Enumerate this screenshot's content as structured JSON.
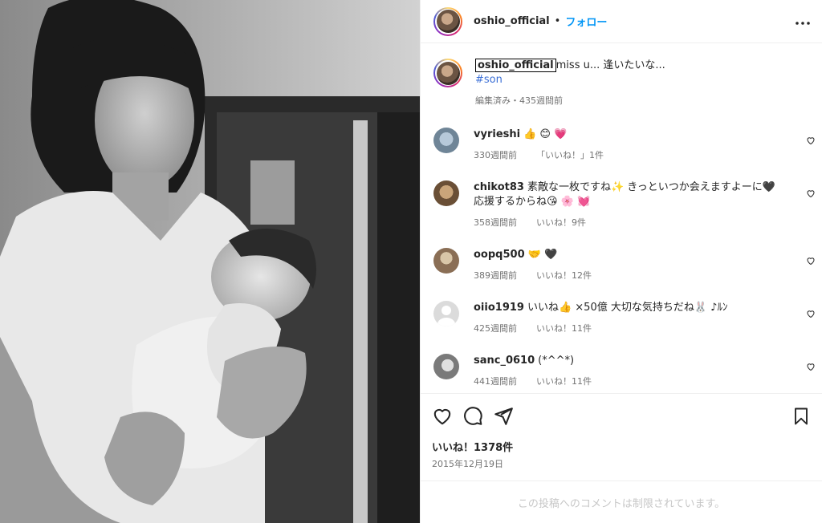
{
  "header": {
    "username": "oshio_official",
    "separator": "•",
    "follow_label": "フォロー",
    "more_icon": "more-horizontal-icon"
  },
  "caption": {
    "username": "oshio_official",
    "text": "miss u... 逢いたいな...",
    "hashtag": "#son",
    "meta": "編集済み・435週間前"
  },
  "comments": [
    {
      "username": "vyrieshi",
      "text": "👍 😊 💗",
      "time": "330週間前",
      "likes": "「いいね！」1件"
    },
    {
      "username": "chikot83",
      "text": "素敵な一枚ですね✨ きっといつか会えますよーに🖤 応援するからね😘 🌸 💓",
      "time": "358週間前",
      "likes": "いいね！9件"
    },
    {
      "username": "oopq500",
      "text": "🤝 🖤",
      "time": "389週間前",
      "likes": "いいね！12件"
    },
    {
      "username": "oiio1919",
      "text": "いいね👍 ×50億 大切な気持ちだね🐰 ♪ﾙﾝ",
      "time": "425週間前",
      "likes": "いいね！11件"
    },
    {
      "username": "sanc_0610",
      "text": "(*^^*)",
      "time": "441週間前",
      "likes": "いいね！11件"
    }
  ],
  "actions": {
    "like_count": "いいね！1378件",
    "date": "2015年12月19日"
  },
  "footer": {
    "restricted_text": "この投稿へのコメントは制限されています。"
  },
  "icons": {
    "like": "heart-icon",
    "comment": "comment-icon",
    "share": "share-icon",
    "save": "bookmark-icon"
  }
}
